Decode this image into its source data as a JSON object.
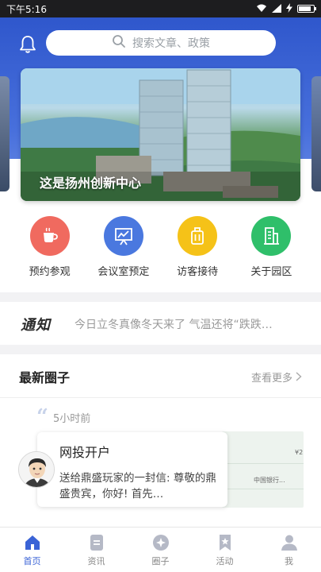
{
  "status_bar": {
    "time": "下午5:16"
  },
  "header": {
    "search_placeholder": "搜索文章、政策"
  },
  "banner": {
    "title": "这是扬州创新中心"
  },
  "quick_menu": [
    {
      "label": "预约参观",
      "icon": "coffee-cup-icon",
      "color": "#f06a5f"
    },
    {
      "label": "会议室预定",
      "icon": "presentation-board-icon",
      "color": "#4a78df"
    },
    {
      "label": "访客接待",
      "icon": "luggage-icon",
      "color": "#f5c218"
    },
    {
      "label": "关于园区",
      "icon": "building-icon",
      "color": "#2fbf6a"
    }
  ],
  "notice": {
    "tag": "通知",
    "text": "今日立冬真像冬天来了 气温还将“跌跌…"
  },
  "circle_section": {
    "title": "最新圈子",
    "more": "查看更多"
  },
  "post": {
    "time": "5小时前",
    "title": "网投开户",
    "body": "送给鼎盛玩家的一封信: 尊敬的鼎盛贵宾，你好! 首先…",
    "image_texts": {
      "amount": "¥2",
      "bank": "中国银行..."
    }
  },
  "tabbar": {
    "items": [
      {
        "label": "首页",
        "icon": "home-icon",
        "active": true
      },
      {
        "label": "资讯",
        "icon": "news-icon",
        "active": false
      },
      {
        "label": "圈子",
        "icon": "circle-chat-icon",
        "active": false
      },
      {
        "label": "活动",
        "icon": "bookmark-star-icon",
        "active": false
      },
      {
        "label": "我",
        "icon": "person-icon",
        "active": false
      }
    ]
  },
  "colors": {
    "primary": "#3a63d6",
    "header": "#2f57cc",
    "inactive": "#b5b9c6"
  }
}
